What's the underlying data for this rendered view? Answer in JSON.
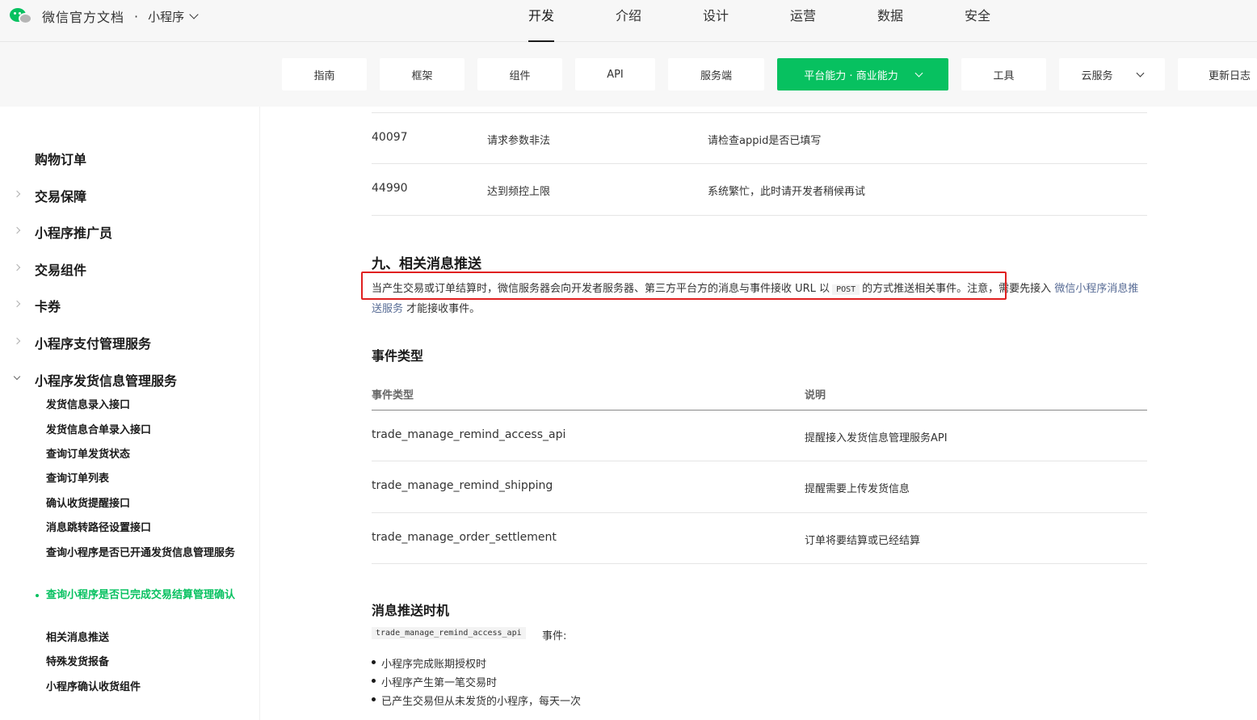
{
  "brand": {
    "title": "微信官方文档",
    "separator": "·",
    "product": "小程序"
  },
  "main_nav": [
    "开发",
    "介绍",
    "设计",
    "运营",
    "数据",
    "安全"
  ],
  "sub_nav": {
    "guide": "指南",
    "framework": "框架",
    "component": "组件",
    "api": "API",
    "server": "服务端",
    "platform": "平台能力 · 商业能力",
    "tools": "工具",
    "cloud": "云服务",
    "changelog": "更新日志"
  },
  "sidebar": {
    "items": [
      "购物订单",
      "交易保障",
      "小程序推广员",
      "交易组件",
      "卡券",
      "小程序支付管理服务",
      "小程序发货信息管理服务"
    ],
    "sub_items": [
      "发货信息录入接口",
      "发货信息合单录入接口",
      "查询订单发货状态",
      "查询订单列表",
      "确认收货提醒接口",
      "消息跳转路径设置接口",
      "查询小程序是否已开通发货信息管理服务",
      "查询小程序是否已完成交易结算管理确认",
      "相关消息推送",
      "特殊发货报备",
      "小程序确认收货组件"
    ]
  },
  "error_table": {
    "rows": [
      {
        "code": "40097",
        "msg": "请求参数非法",
        "solution": "请检查appid是否已填写"
      },
      {
        "code": "44990",
        "msg": "达到频控上限",
        "solution": "系统繁忙，此时请开发者稍候再试"
      }
    ]
  },
  "section9": {
    "title": "九、相关消息推送",
    "para_part1": "当产生交易或订单结算时，微信服务器会向开发者服务器、第三方平台方的消息与事件接收 URL 以",
    "para_code": "POST",
    "para_part2": "的方式推送相关事件。注意，需要先接入",
    "para_link": "微信小程序消息推送服务",
    "para_part3": "才能接收事件。"
  },
  "event_types": {
    "title": "事件类型",
    "headers": [
      "事件类型",
      "说明"
    ],
    "rows": [
      {
        "type": "trade_manage_remind_access_api",
        "desc": "提醒接入发货信息管理服务API"
      },
      {
        "type": "trade_manage_remind_shipping",
        "desc": "提醒需要上传发货信息"
      },
      {
        "type": "trade_manage_order_settlement",
        "desc": "订单将要结算或已经结算"
      }
    ]
  },
  "push_timing": {
    "title": "消息推送时机",
    "code": "trade_manage_remind_access_api",
    "suffix": "事件:",
    "bullets": [
      "小程序完成账期授权时",
      "小程序产生第一笔交易时",
      "已产生交易但从未发货的小程序，每天一次"
    ]
  },
  "colors": {
    "accent": "#07c160",
    "highlight_box": "#e02020",
    "link": "#576b95"
  }
}
